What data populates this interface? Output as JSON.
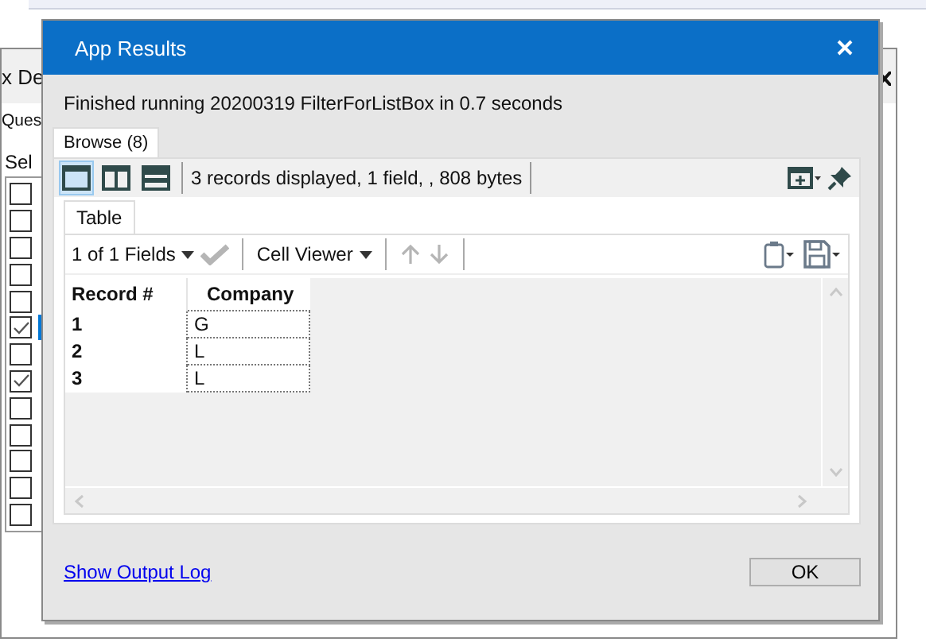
{
  "background_window": {
    "title": "x De",
    "tab": "Ques",
    "label": "Sel",
    "items": [
      {
        "checked": false,
        "selected": false
      },
      {
        "checked": false,
        "selected": false
      },
      {
        "checked": false,
        "selected": false
      },
      {
        "checked": false,
        "selected": false
      },
      {
        "checked": false,
        "selected": false
      },
      {
        "checked": true,
        "selected": true
      },
      {
        "checked": false,
        "selected": false
      },
      {
        "checked": true,
        "selected": false
      },
      {
        "checked": false,
        "selected": false
      },
      {
        "checked": false,
        "selected": false
      },
      {
        "checked": false,
        "selected": false
      },
      {
        "checked": false,
        "selected": false
      },
      {
        "checked": false,
        "selected": false
      }
    ]
  },
  "dialog": {
    "title": "App Results",
    "message": "Finished running 20200319 FilterForListBox in 0.7 seconds",
    "tabs": [
      {
        "label": "Browse (8)",
        "selected": true
      }
    ],
    "layouts": [
      {
        "kind": "single",
        "selected": true
      },
      {
        "kind": "columns",
        "selected": false
      },
      {
        "kind": "rows",
        "selected": false
      }
    ],
    "summary": "3 records displayed, 1 field, , 808 bytes",
    "inner_tabs": [
      {
        "label": "Table",
        "selected": true
      }
    ],
    "fields_dropdown": "1 of 1 Fields",
    "cell_viewer": "Cell Viewer",
    "table": {
      "columns": [
        "Record #",
        "Company"
      ],
      "rows": [
        [
          "1",
          "G"
        ],
        [
          "2",
          "L"
        ],
        [
          "3",
          "L"
        ]
      ]
    },
    "link": "Show Output Log",
    "ok_button": "OK"
  }
}
